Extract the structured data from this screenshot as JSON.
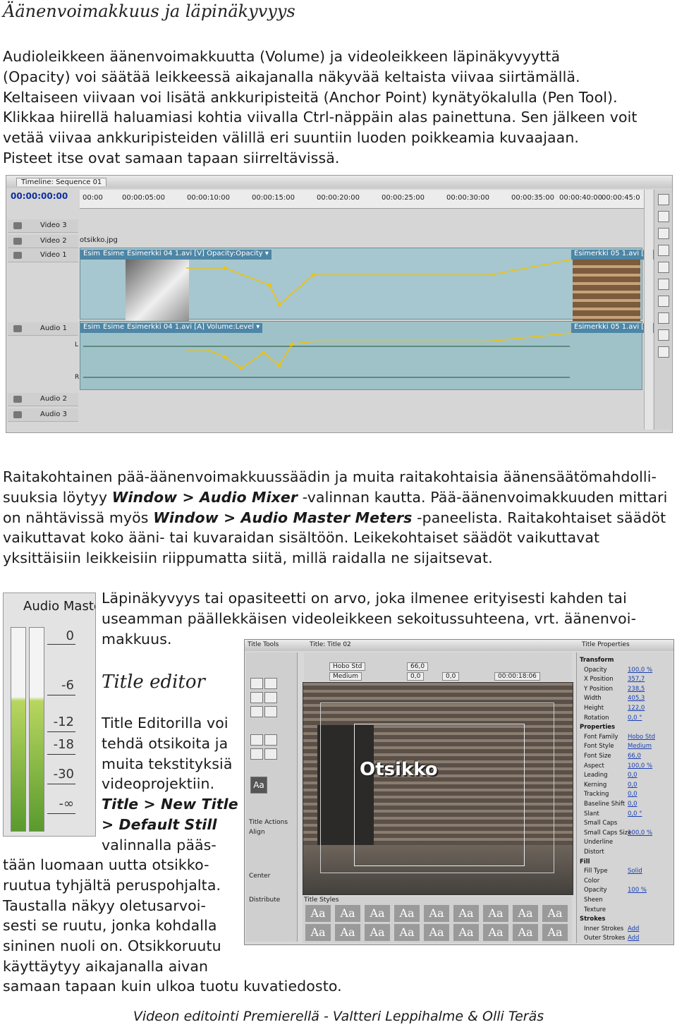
{
  "section1": {
    "heading": "Äänenvoimakkuus ja läpinäkyvyys",
    "lines": [
      "Audioleikkeen äänenvoimakkuutta (Volume) ja videoleikkeen läpinäkyvyyttä",
      "(Opacity) voi säätää leikkeessä aikajanalla näkyvää keltaista viivaa siirtämällä.",
      "Keltaiseen viivaan voi lisätä ankkuripisteitä (Anchor Point) kynätyökalulla (Pen Tool).",
      "Klikkaa hiirellä haluamiasi kohtia viivalla Ctrl-näppäin alas painettuna. Sen jälkeen voit",
      "vetää viivaa ankkuripisteiden välillä eri suuntiin luoden poikkeamia kuvaajaan.",
      "Pisteet itse ovat samaan tapaan siirreltävissä."
    ]
  },
  "timeline": {
    "tab": "Timeline: Sequence 01",
    "timecode": "00:00:00:00",
    "ruler": [
      "00:00",
      "00:00:05:00",
      "00:00:10:00",
      "00:00:15:00",
      "00:00:20:00",
      "00:00:25:00",
      "00:00:30:00",
      "00:00:35:00",
      "00:00:40:00",
      "00:00:45:0"
    ],
    "tracks": [
      "Video 3",
      "Video 2",
      "Video 1",
      "Audio 1",
      "Audio 2",
      "Audio 3"
    ],
    "v2_clip": "otsikko.jpg",
    "v1_clips": [
      "Esim",
      "Esimerk",
      "Esimerkki 04 1.avi [V]  Opacity:Opacity ▾",
      "Esimerkki 05 1.avi [V]"
    ],
    "a1_clips": [
      "Esim",
      "Esimerk",
      "Esimerkki 04 1.avi [A]  Volume:Level ▾",
      "Esimerkki 05 1.avi [A]"
    ],
    "channel_left": "L",
    "channel_right": "R"
  },
  "section2": {
    "l1": "Raitakohtainen pää-äänenvoimakkuussäädin ja muita raitakohtaisia äänensäätömahdolli-",
    "l2a": "suuksia löytyy ",
    "l2b": "Window > Audio Mixer",
    "l2c": " -valinnan kautta. Pää-äänenvoimakkuuden mittari",
    "l3a": "on nähtävissä myös ",
    "l3b": "Window > Audio Master Meters",
    "l3c": " -paneelista. Raitakohtaiset säädöt",
    "l4": "vaikuttavat koko ääni- tai kuvaraidan sisältöön. Leikekohtaiset säädöt vaikuttavat",
    "l5": "yksittäisiin leikkeisiin riippumatta siitä, millä raidalla ne sijaitsevat."
  },
  "audio_master": {
    "title": "Audio Maste",
    "levels": [
      "0",
      "-6",
      "-12",
      "-18",
      "-30",
      "-∞"
    ]
  },
  "opacity_text": {
    "lines": [
      "Läpinäkyvyys tai opasiteetti on arvo, joka ilmenee erityisesti kahden tai",
      "useamman päällekkäisen videoleikkeen sekoitussuhteena, vrt. äänenvoi-",
      "makkuus."
    ]
  },
  "title_editor": {
    "heading": "Title editor",
    "narrow": [
      "Title Editorilla voi",
      "tehdä otsikoita ja",
      "muita tekstityksiä",
      "videoprojektiin."
    ],
    "menu1": "Title > New Title",
    "menu2": "> Default Still",
    "narrow2": [
      "valinnalla pääs-"
    ],
    "wide": [
      "tään luomaan uutta otsikko-",
      "ruutua tyhjältä peruspohjalta.",
      "Taustalla näkyy oletusarvoi-",
      "sesti se ruutu, jonka kohdalla",
      "sininen nuoli on. Otsikkoruutu",
      "käyttäytyy aikajanalla aivan"
    ],
    "last": "samaan tapaan kuin ulkoa tuotu kuvatiedosto."
  },
  "title_window": {
    "tab_tools": "Title Tools",
    "tab_title": "Title: Title 02",
    "tab_props": "Title Properties",
    "font": "Hobo Std",
    "style": "Medium",
    "size": "66,0",
    "kern": "0,0",
    "lead": "0,0",
    "tc": "00:00:18:06",
    "actions": "Title Actions",
    "align": "Align",
    "center": "Center",
    "distribute": "Distribute",
    "styles_hdr": "Title Styles",
    "canvas_text": "Otsikko",
    "sample": "Aa",
    "props": [
      {
        "k": "Transform",
        "v": "",
        "sec": true
      },
      {
        "k": "Opacity",
        "v": "100,0 %"
      },
      {
        "k": "X Position",
        "v": "357,7"
      },
      {
        "k": "Y Position",
        "v": "238,5"
      },
      {
        "k": "Width",
        "v": "405,3"
      },
      {
        "k": "Height",
        "v": "122,0"
      },
      {
        "k": "Rotation",
        "v": "0,0 °"
      },
      {
        "k": "Properties",
        "v": "",
        "sec": true
      },
      {
        "k": "Font Family",
        "v": "Hobo Std"
      },
      {
        "k": "Font Style",
        "v": "Medium"
      },
      {
        "k": "Font Size",
        "v": "66,0"
      },
      {
        "k": "Aspect",
        "v": "100,0 %"
      },
      {
        "k": "Leading",
        "v": "0,0"
      },
      {
        "k": "Kerning",
        "v": "0,0"
      },
      {
        "k": "Tracking",
        "v": "0,0"
      },
      {
        "k": "Baseline Shift",
        "v": "0,0"
      },
      {
        "k": "Slant",
        "v": "0,0 °"
      },
      {
        "k": "Small Caps",
        "v": ""
      },
      {
        "k": "Small Caps Size",
        "v": "100,0 %"
      },
      {
        "k": "Underline",
        "v": ""
      },
      {
        "k": "Distort",
        "v": ""
      },
      {
        "k": "Fill",
        "v": "",
        "sec": true
      },
      {
        "k": "Fill Type",
        "v": "Solid"
      },
      {
        "k": "Color",
        "v": ""
      },
      {
        "k": "Opacity",
        "v": "100 %"
      },
      {
        "k": "Sheen",
        "v": ""
      },
      {
        "k": "Texture",
        "v": ""
      },
      {
        "k": "Strokes",
        "v": "",
        "sec": true
      },
      {
        "k": "Inner Strokes",
        "v": "Add"
      },
      {
        "k": "Outer Strokes",
        "v": "Add"
      }
    ]
  },
  "footer": "Videon editointi Premierellä - Valtteri Leppihalme & Olli Teräs"
}
